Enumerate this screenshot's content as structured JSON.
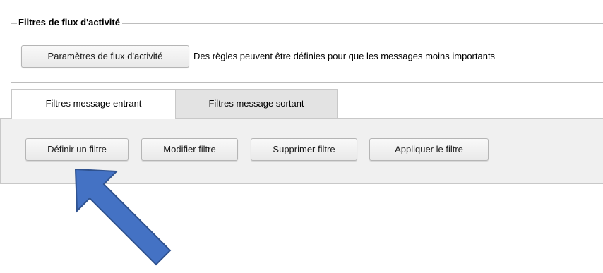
{
  "activity_filters": {
    "group_title": "Filtres de flux d'activité",
    "settings_button_label": "Paramètres de flux d'activité",
    "description": "Des règles peuvent être définies pour que les messages moins importants"
  },
  "tabs": [
    {
      "label": "Filtres message entrant",
      "active": true
    },
    {
      "label": "Filtres message sortant",
      "active": false
    }
  ],
  "toolbar": {
    "define_label": "Définir un filtre",
    "modify_label": "Modifier filtre",
    "delete_label": "Supprimer filtre",
    "apply_label": "Appliquer le filtre"
  },
  "annotation": {
    "arrow_color": "#4472c4",
    "arrow_stroke": "#2f528f",
    "target": "define-filter-button"
  }
}
